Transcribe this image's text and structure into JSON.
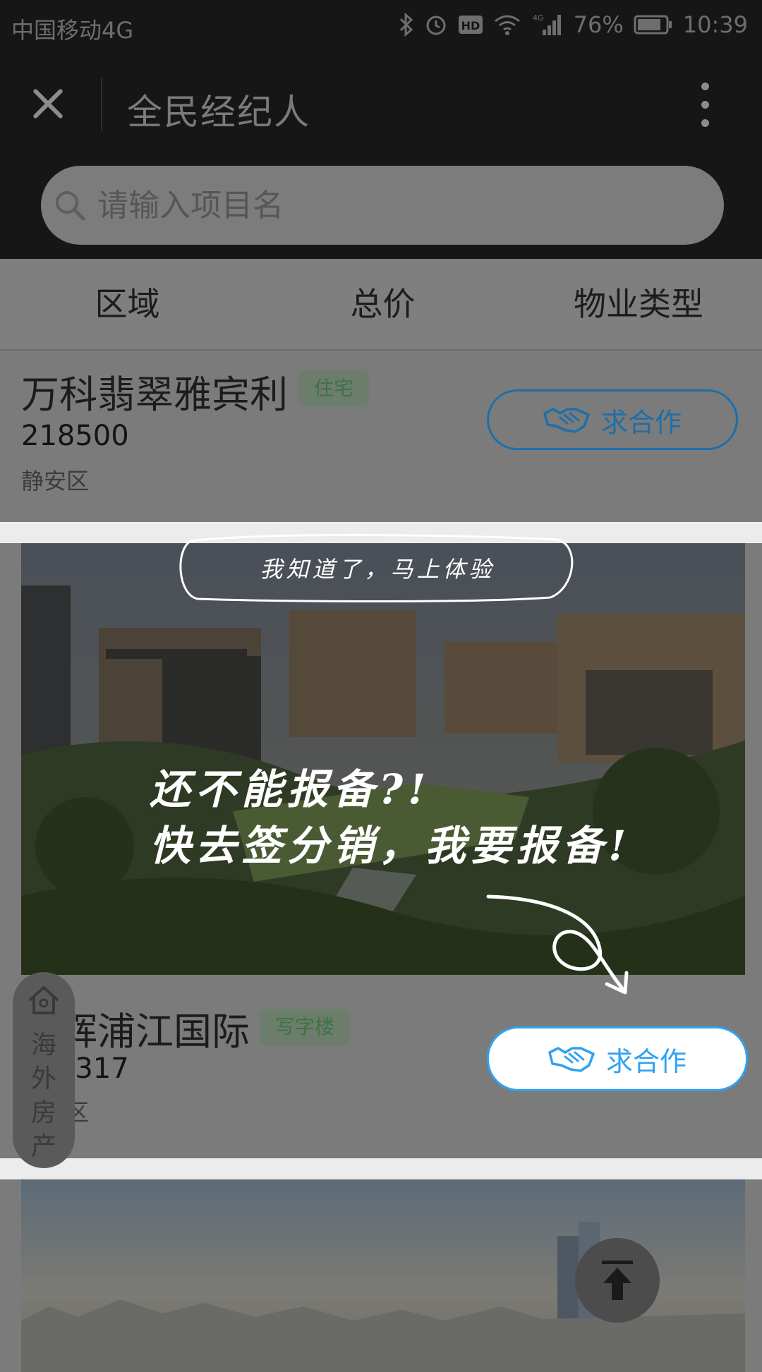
{
  "status": {
    "carrier": "中国移动4G",
    "battery": "76%",
    "time": "10:39"
  },
  "header": {
    "title": "全民经纪人"
  },
  "search": {
    "placeholder": "请输入项目名"
  },
  "filters": [
    "区域",
    "总价",
    "物业类型"
  ],
  "listings": [
    {
      "name": "万科翡翠雅宾利",
      "tag": "住宅",
      "price": "218500",
      "district": "静安区",
      "button": "求合作"
    },
    {
      "name": "旭辉浦江国际",
      "tag": "写字楼",
      "price": "130317",
      "district": "闵行区",
      "button": "求合作"
    }
  ],
  "floating": {
    "badge": "海外房产"
  },
  "guide": {
    "dismiss": "我知道了，马上体验",
    "line1": "还不能报备?!",
    "line2": "快去签分销，我要报备!"
  },
  "colors": {
    "accent": "#2fa2f0",
    "tag_green": "#3f7345"
  }
}
